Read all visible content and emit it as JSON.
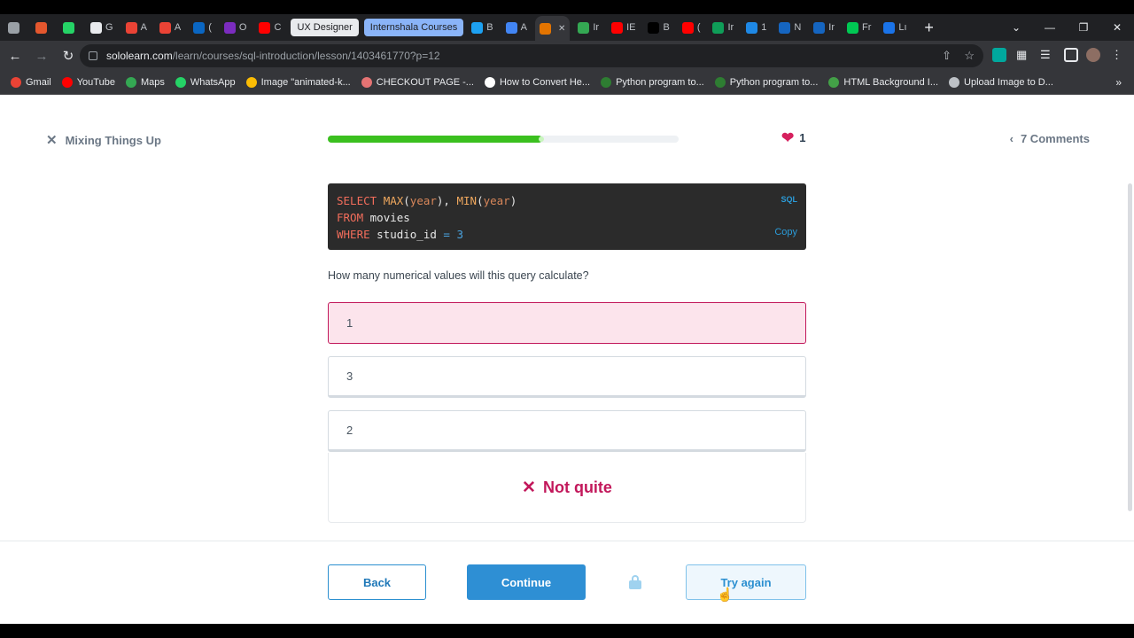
{
  "browser": {
    "tabs": [
      {
        "letter": "",
        "color": "#9aa0a6"
      },
      {
        "letter": "",
        "color": "#e4572e"
      },
      {
        "letter": "",
        "color": "#25d366"
      },
      {
        "letter": "G",
        "color": "#e8eaed"
      },
      {
        "letter": "A",
        "color": "#ea4335"
      },
      {
        "letter": "A",
        "color": "#ea4335"
      },
      {
        "letter": "(",
        "color": "#0a66c2"
      },
      {
        "letter": "O",
        "color": "#7b2cbf"
      },
      {
        "letter": "C",
        "color": "#ff0000"
      }
    ],
    "pill_tabs": [
      {
        "label": "UX Designer",
        "bg": "#e8eaed",
        "fg": "#202124"
      },
      {
        "label": "Internshala Courses",
        "bg": "#8ab4f8",
        "fg": "#202124"
      }
    ],
    "tabs_after": [
      {
        "letter": "B",
        "color": "#1da1f2"
      },
      {
        "letter": "A",
        "color": "#4285f4"
      },
      {
        "letter": "",
        "color": "#e37400",
        "active": true
      },
      {
        "letter": "Ir",
        "color": "#34a853"
      },
      {
        "letter": "IE",
        "color": "#ff0000"
      },
      {
        "letter": "B",
        "color": "#000000"
      },
      {
        "letter": "(",
        "color": "#ff0000"
      },
      {
        "letter": "Ir",
        "color": "#0f9d58"
      },
      {
        "letter": "1",
        "color": "#1e88e5"
      },
      {
        "letter": "N",
        "color": "#1565c0"
      },
      {
        "letter": "Ir",
        "color": "#1565c0"
      },
      {
        "letter": "Fr",
        "color": "#00c853"
      },
      {
        "letter": "Lı",
        "color": "#1a73e8"
      }
    ],
    "url_host": "sololearn.com",
    "url_path": "/learn/courses/sql-introduction/lesson/1403461770?p=12",
    "bookmarks": [
      {
        "label": "Gmail",
        "color": "#ea4335"
      },
      {
        "label": "YouTube",
        "color": "#ff0000"
      },
      {
        "label": "Maps",
        "color": "#34a853"
      },
      {
        "label": "WhatsApp",
        "color": "#25d366"
      },
      {
        "label": "Image \"animated-k...",
        "color": "#fbbc04"
      },
      {
        "label": "CHECKOUT PAGE -...",
        "color": "#e57373"
      },
      {
        "label": "How to Convert He...",
        "color": "#ffffff"
      },
      {
        "label": "Python program to...",
        "color": "#2e7d32"
      },
      {
        "label": "Python program to...",
        "color": "#2e7d32"
      },
      {
        "label": "HTML Background I...",
        "color": "#43a047"
      },
      {
        "label": "Upload Image to D...",
        "color": "#bdc1c6"
      }
    ]
  },
  "lesson": {
    "title": "Mixing Things Up",
    "progress": 0.61,
    "hearts": "1",
    "comments": "7 Comments"
  },
  "code": {
    "lang": "SQL",
    "copy_label": "Copy",
    "lines": [
      [
        {
          "t": "SELECT ",
          "c": "kw"
        },
        {
          "t": "MAX",
          "c": "fn"
        },
        {
          "t": "(",
          "c": ""
        },
        {
          "t": "year",
          "c": "col"
        },
        {
          "t": "), ",
          "c": ""
        },
        {
          "t": "MIN",
          "c": "fn"
        },
        {
          "t": "(",
          "c": ""
        },
        {
          "t": "year",
          "c": "col"
        },
        {
          "t": ")",
          "c": ""
        }
      ],
      [
        {
          "t": "FROM ",
          "c": "kw"
        },
        {
          "t": "movies",
          "c": ""
        }
      ],
      [
        {
          "t": "WHERE ",
          "c": "kw"
        },
        {
          "t": "studio_id ",
          "c": ""
        },
        {
          "t": "= ",
          "c": "op"
        },
        {
          "t": "3",
          "c": "num"
        }
      ]
    ]
  },
  "question": "How many numerical values will this query calculate?",
  "options": [
    {
      "label": "1",
      "selected": true
    },
    {
      "label": "3",
      "selected": false
    },
    {
      "label": "2",
      "selected": false
    }
  ],
  "feedback": "Not quite",
  "buttons": {
    "back": "Back",
    "continue": "Continue",
    "try_again": "Try again"
  }
}
